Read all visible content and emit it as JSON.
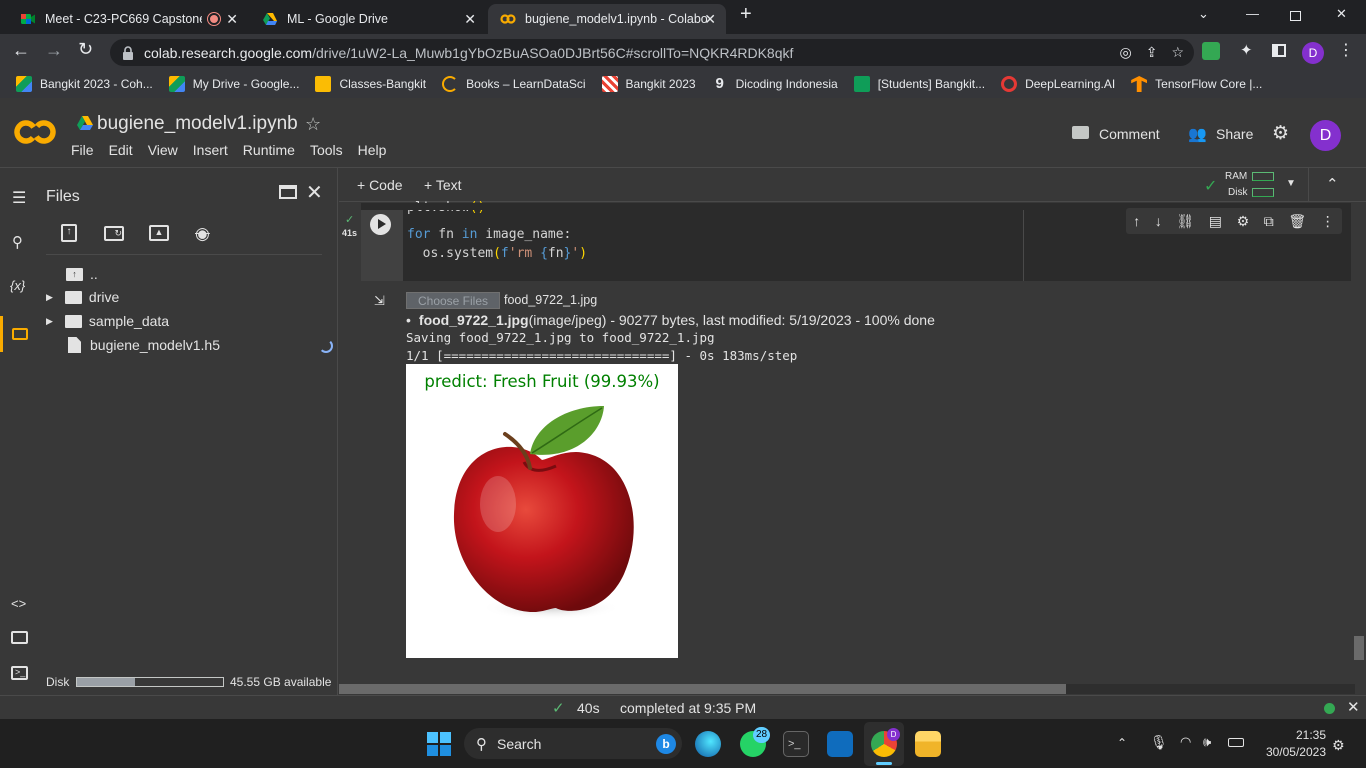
{
  "browser": {
    "tabs": [
      {
        "title": "Meet - C23-PC669 Capstone",
        "icon": "google-meet-icon"
      },
      {
        "title": "ML - Google Drive",
        "icon": "google-drive-icon"
      },
      {
        "title": "bugiene_modelv1.ipynb - Colabo",
        "icon": "colab-icon"
      }
    ],
    "url_domain": "colab.research.google.com",
    "url_path": "/drive/1uW2-La_Muwb1gYbOzBuASOa0DJBrt56C#scrollTo=NQKR4RDK8qkf",
    "profile_initial": "D",
    "bookmarks": [
      {
        "label": "Bangkit 2023 - Coh...",
        "icon": "google-drive-icon"
      },
      {
        "label": "My Drive - Google...",
        "icon": "google-drive-icon"
      },
      {
        "label": "Classes-Bangkit",
        "icon": "classroom-icon"
      },
      {
        "label": "Books – LearnDataSci",
        "icon": "learndatasci-icon"
      },
      {
        "label": "Bangkit 2023",
        "icon": "bangkit-icon"
      },
      {
        "label": "Dicoding Indonesia",
        "icon": "dicoding-icon"
      },
      {
        "label": "[Students] Bangkit...",
        "icon": "sheets-icon"
      },
      {
        "label": "DeepLearning.AI",
        "icon": "deeplearning-icon"
      },
      {
        "label": "TensorFlow Core |...",
        "icon": "tensorflow-icon"
      }
    ]
  },
  "colab": {
    "notebook_title": "bugiene_modelv1.ipynb",
    "menu": [
      "File",
      "Edit",
      "View",
      "Insert",
      "Runtime",
      "Tools",
      "Help"
    ],
    "comment_label": "Comment",
    "share_label": "Share",
    "avatar_initial": "D",
    "add_code": "+ Code",
    "add_text": "+ Text",
    "ram_label": "RAM",
    "disk_label": "Disk"
  },
  "files_panel": {
    "title": "Files",
    "items": [
      {
        "name": "..",
        "type": "parent"
      },
      {
        "name": "drive",
        "type": "folder"
      },
      {
        "name": "sample_data",
        "type": "folder"
      },
      {
        "name": "bugiene_modelv1.h5",
        "type": "file"
      }
    ],
    "disk_label": "Disk",
    "disk_available": "45.55 GB available",
    "disk_usage_fraction": 0.4
  },
  "cell": {
    "exec_time": "41s",
    "code_lines": [
      "plt.show()",
      "for fn in image_name:",
      "  os.system(f'rm {fn}')"
    ]
  },
  "output": {
    "choose_files_label": "Choose Files",
    "chosen_file": "food_9722_1.jpg",
    "file_name_bold": "food_9722_1.jpg",
    "file_meta": "(image/jpeg) - 90277 bytes, last modified: 5/19/2023 - 100% done",
    "saving_line": "Saving food_9722_1.jpg to food_9722_1.jpg",
    "progress_line": "1/1 [==============================] - 0s 183ms/step",
    "prediction": "predict: Fresh Fruit (99.93%)"
  },
  "status_bar": {
    "duration": "40s",
    "completed": "completed at 9:35 PM"
  },
  "taskbar": {
    "search_label": "Search",
    "whatsapp_badge": "28",
    "time": "21:35",
    "date": "30/05/2023"
  },
  "colors": {
    "colab_orange": "#f9ab00",
    "prediction_green": "#008000",
    "profile_purple": "#8430ce"
  }
}
